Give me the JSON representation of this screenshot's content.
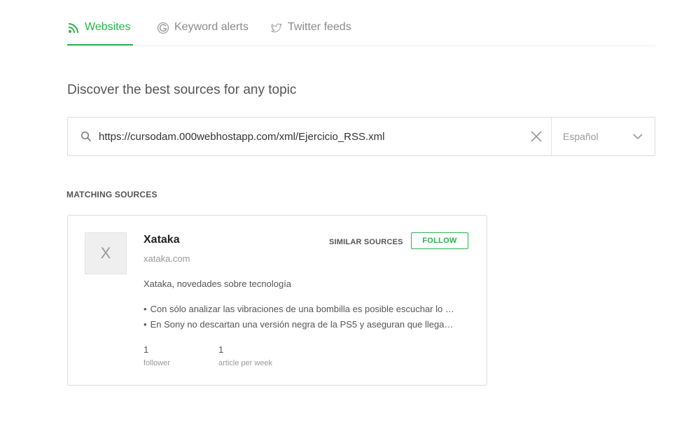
{
  "tabs": [
    {
      "label": "Websites",
      "icon": "rss-icon",
      "active": true
    },
    {
      "label": "Keyword alerts",
      "icon": "google-icon",
      "active": false
    },
    {
      "label": "Twitter feeds",
      "icon": "twitter-icon",
      "active": false
    }
  ],
  "heading": "Discover the best sources for any topic",
  "search": {
    "value": "https://cursodam.000webhostapp.com/xml/Ejercicio_RSS.xml",
    "icon": "search-icon",
    "clear_icon": "close-icon"
  },
  "language": {
    "selected": "Español",
    "icon": "chevron-down-icon"
  },
  "section_label": "MATCHING SOURCES",
  "source": {
    "avatar_letter": "X",
    "name": "Xataka",
    "domain": "xataka.com",
    "description": "Xataka, novedades sobre tecnología",
    "similar_label": "SIMILAR SOURCES",
    "follow_label": "FOLLOW",
    "articles": [
      "Con sólo analizar las vibraciones de una bombilla es posible escuchar lo que se dice en una habitación",
      "En Sony no descartan una versión negra de la PS5 y aseguran que llegará en el futuro"
    ],
    "followers": "1",
    "followers_label": "follower",
    "articles_per_week": "1",
    "articles_per_week_label": "article per week"
  },
  "colors": {
    "accent": "#2bb24c",
    "muted": "#8a8a8a",
    "border": "#dcdcdc"
  }
}
